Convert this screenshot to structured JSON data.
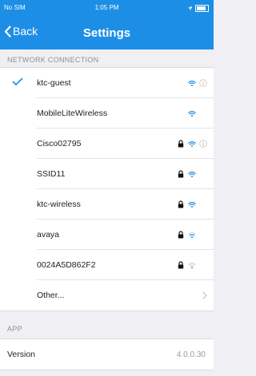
{
  "status_bar": {
    "carrier": "No SIM",
    "time": "1:05 PM"
  },
  "nav": {
    "back_label": "Back",
    "title": "Settings"
  },
  "network_section": {
    "header": "NETWORK CONNECTION",
    "networks": [
      {
        "name": "ktc-guest",
        "selected": true,
        "locked": false,
        "signal": "strong",
        "info": true
      },
      {
        "name": "MobileLiteWireless",
        "selected": false,
        "locked": false,
        "signal": "strong",
        "info": false
      },
      {
        "name": "Cisco02795",
        "selected": false,
        "locked": true,
        "signal": "strong",
        "info": true
      },
      {
        "name": "SSID11",
        "selected": false,
        "locked": true,
        "signal": "strong",
        "info": false
      },
      {
        "name": "ktc-wireless",
        "selected": false,
        "locked": true,
        "signal": "strong",
        "info": false
      },
      {
        "name": "avaya",
        "selected": false,
        "locked": true,
        "signal": "medium",
        "info": false
      },
      {
        "name": "0024A5D862F2",
        "selected": false,
        "locked": true,
        "signal": "weak",
        "info": false
      }
    ],
    "other_label": "Other..."
  },
  "app_section": {
    "header": "APP",
    "version_label": "Version",
    "version_value": "4.0.0.30"
  },
  "colors": {
    "accent": "#1c8ee6",
    "header_text": "#8e8e93",
    "background": "#efeff4"
  },
  "icons": [
    "back-chevron-icon",
    "checkmark-icon",
    "wifi-icon",
    "lock-icon",
    "info-icon",
    "chevron-right-icon",
    "location-icon",
    "battery-icon"
  ]
}
